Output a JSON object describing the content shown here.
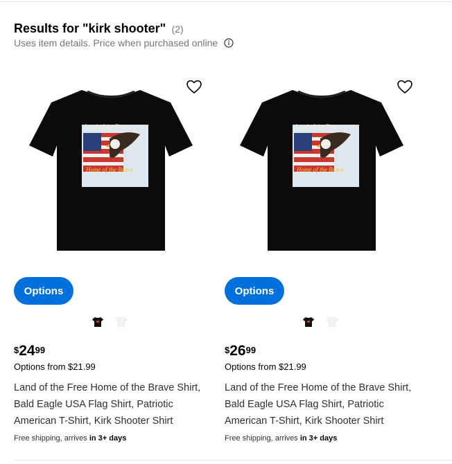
{
  "header": {
    "title": "Results for \"kirk shooter\"",
    "count": "(2)",
    "subtitle": "Uses item details. Price when purchased online"
  },
  "products": [
    {
      "options_label": "Options",
      "price_currency": "$",
      "price_dollars": "24",
      "price_cents": "99",
      "options_from": "Options from $21.99",
      "title": "Land of the Free Home of the Brave Shirt, Bald Eagle USA Flag Shirt, Patriotic American T-Shirt, Kirk Shooter Shirt",
      "shipping_prefix": "Free shipping, arrives ",
      "shipping_eta": "in 3+ days",
      "print_text_top": "Land of the Free",
      "print_text_bottom": "Home of the Brave"
    },
    {
      "options_label": "Options",
      "price_currency": "$",
      "price_dollars": "26",
      "price_cents": "99",
      "options_from": "Options from $21.99",
      "title": "Land of the Free Home of the Brave Shirt, Bald Eagle USA Flag Shirt, Patriotic American T-Shirt, Kirk Shooter Shirt",
      "shipping_prefix": "Free shipping, arrives ",
      "shipping_eta": "in 3+ days",
      "print_text_top": "Land of the Free",
      "print_text_bottom": "Home of the Brave"
    }
  ],
  "icons": {
    "favorite": "heart-icon",
    "info": "info-icon",
    "swatch_black": "black-shirt-swatch",
    "swatch_white": "white-shirt-swatch"
  },
  "colors": {
    "accent": "#0071dc",
    "shirt": "#0b0b0b"
  }
}
